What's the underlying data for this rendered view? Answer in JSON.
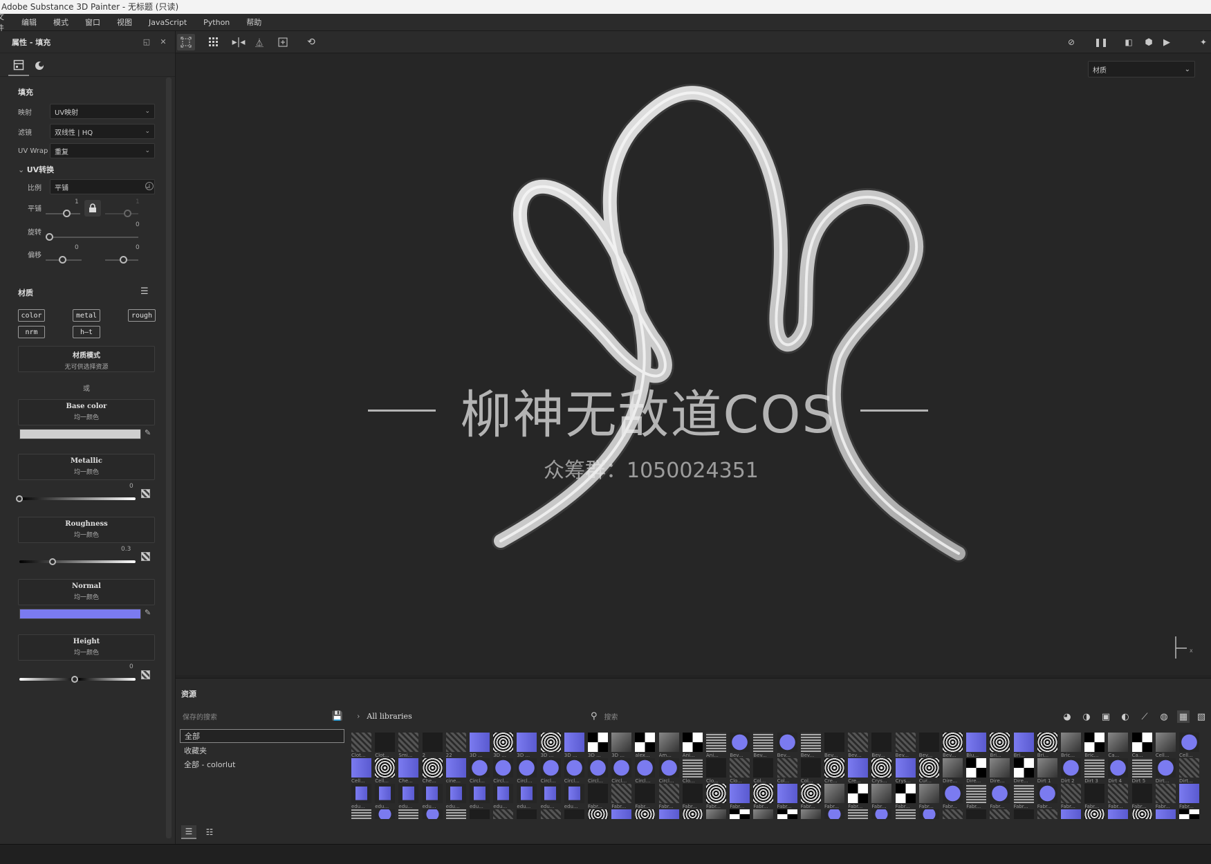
{
  "window": {
    "title": "Adobe Substance 3D Painter - 无标题 (只读)"
  },
  "menu": [
    "文件",
    "编辑",
    "模式",
    "窗口",
    "视图",
    "JavaScript",
    "Python",
    "帮助"
  ],
  "properties_panel": {
    "title": "属性 - 填充",
    "fill_section": "填充",
    "mapping_label": "映射",
    "mapping_value": "UV映射",
    "filter_label": "滤镜",
    "filter_value": "双线性 | HQ",
    "uvwrap_label": "UV Wrap",
    "uvwrap_value": "重复",
    "uv_transform_label": "UV转换",
    "scale_label": "比例",
    "scale_value": "平铺",
    "tile_label": "平铺",
    "tile_value_a": "1",
    "tile_value_b": "1",
    "rotate_label": "旋转",
    "rotate_value": "0",
    "offset_label": "偏移",
    "offset_value_a": "0",
    "offset_value_b": "0",
    "material_section": "材质",
    "channels": [
      "color",
      "metal",
      "rough",
      "nrm",
      "h—t"
    ],
    "material_mode_title": "材质模式",
    "material_mode_sub": "无可供选择资源",
    "or_label": "或",
    "base_color": {
      "title": "Base color",
      "sub": "均一颜色",
      "color": "#cfcfcf"
    },
    "metallic": {
      "title": "Metallic",
      "sub": "均一颜色",
      "value": "0",
      "fraction": 0.0
    },
    "roughness": {
      "title": "Roughness",
      "sub": "均一颜色",
      "value": "0.3",
      "fraction": 0.3
    },
    "normal": {
      "title": "Normal",
      "sub": "均一颜色",
      "color": "#7b7bf0"
    },
    "height": {
      "title": "Height",
      "sub": "均一颜色",
      "value": "0",
      "fraction": 0.5
    }
  },
  "viewport": {
    "material_dropdown": "材质",
    "watermark_main": "柳神无敌道COS",
    "watermark_sub": "众筹群：1050024351",
    "axis_label": "x"
  },
  "assets": {
    "title": "资源",
    "saved_search_placeholder": "保存的搜索",
    "libraries": [
      "全部",
      "收藏夹",
      "全部 - colorlut"
    ],
    "breadcrumb": "All libraries",
    "search_placeholder": "搜索",
    "thumb_rows": [
      [
        "Clot...",
        "Clot...",
        "Smi...",
        "2",
        "22",
        "3D ...",
        "3D ...",
        "3D ...",
        "3D ...",
        "3D ...",
        "3D ...",
        "3D ...",
        "alex...",
        "Am...",
        "Ani...",
        "Ani...",
        "Bev...",
        "Bev...",
        "Bev...",
        "Bev...",
        "Bev...",
        "Bev...",
        "Bev...",
        "Bev...",
        "Bev...",
        "Bev...",
        "Blu...",
        "Bri...",
        "Bri...",
        "Bri...",
        "Bric...",
        "Bric...",
        "Ca...",
        "Ca...",
        "Cell...",
        "Cell..."
      ],
      [
        "Cell...",
        "Cell...",
        "Che...",
        "Che...",
        "cine...",
        "Circl...",
        "Circl...",
        "Circl...",
        "Circl...",
        "Circl...",
        "Circl...",
        "Circl...",
        "Circl...",
        "Circl...",
        "Clo...",
        "Clo...",
        "Clo...",
        "Col...",
        "Col...",
        "Col...",
        "Cre...",
        "Cre...",
        "Crys...",
        "Crys...",
        "Cur...",
        "Dire...",
        "Dire...",
        "Dire...",
        "Dire...",
        "Dirt 1",
        "Dirt 2",
        "Dirt 3",
        "Dirt 4",
        "Dirt 5",
        "Dirt...",
        "Dirt..."
      ],
      [
        "edu...",
        "edu...",
        "edu...",
        "edu...",
        "edu...",
        "edu...",
        "edu...",
        "edu...",
        "edu...",
        "edu...",
        "Fabr...",
        "Fabr...",
        "Fabr...",
        "Fabr...",
        "Fabr...",
        "Fabr...",
        "Fabr...",
        "Fabr...",
        "Fabr...",
        "Fabr...",
        "Fabr...",
        "Fabr...",
        "Fabr...",
        "Fabr...",
        "Fabr...",
        "Fabr...",
        "Fabr...",
        "Fabr...",
        "Fabr...",
        "Fabr...",
        "Fabr...",
        "Fabr...",
        "Fabr...",
        "Fabr...",
        "Fabr...",
        "Fabr..."
      ],
      [
        "",
        "",
        "",
        "",
        "",
        "",
        "",
        "",
        "",
        "",
        "",
        "",
        "",
        "",
        "",
        "",
        "",
        "",
        "",
        "",
        "",
        "",
        "",
        "",
        "",
        "",
        "",
        "",
        "",
        "",
        "",
        "",
        "",
        "",
        "",
        ""
      ]
    ]
  },
  "colors": {
    "accent_blue": "#7b7bf0",
    "bg": "#232323",
    "panel": "#2b2b2b"
  }
}
